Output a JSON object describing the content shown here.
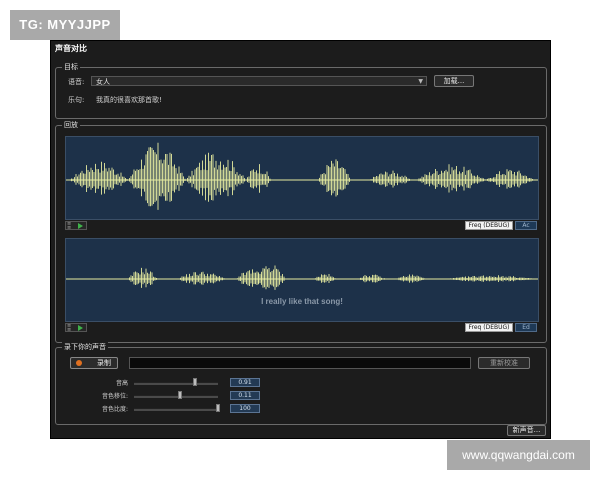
{
  "watermarks": {
    "top_left": "TG: MYYJJPP",
    "bottom_right": "www.qqwangdai.com"
  },
  "window": {
    "title": "声音对比"
  },
  "target": {
    "group_label": "目标",
    "voice_label": "语音:",
    "voice_value": "女人",
    "load_button": "加载...",
    "lyrics_label": "乐句:",
    "lyrics_value": "我真的很喜欢那首歌!"
  },
  "compare": {
    "group_label": "回放",
    "top_panel": {
      "freq_button": "Freq (DEBUG)",
      "side_button": "Ac"
    },
    "bottom_panel": {
      "caption": "I really like that song!",
      "freq_button": "Freq (DEBUG)",
      "side_button": "Ed"
    }
  },
  "record": {
    "group_label": "录下你的声音",
    "record_button": "录制",
    "reset_button": "重新校准",
    "sliders": [
      {
        "label": "音高",
        "value": "0.91",
        "position": 0.72
      },
      {
        "label": "音色移位:",
        "value": "0.11",
        "position": 0.54
      },
      {
        "label": "音色比度:",
        "value": "100",
        "position": 1.0
      }
    ]
  },
  "footer": {
    "new_voice_button": "新声音..."
  },
  "colors": {
    "waveform": "#e6eba0",
    "panel_bg": "#1d3149",
    "window_bg": "#1c1c1c",
    "record_dot": "#e07020",
    "play_icon": "#3fb24a"
  }
}
